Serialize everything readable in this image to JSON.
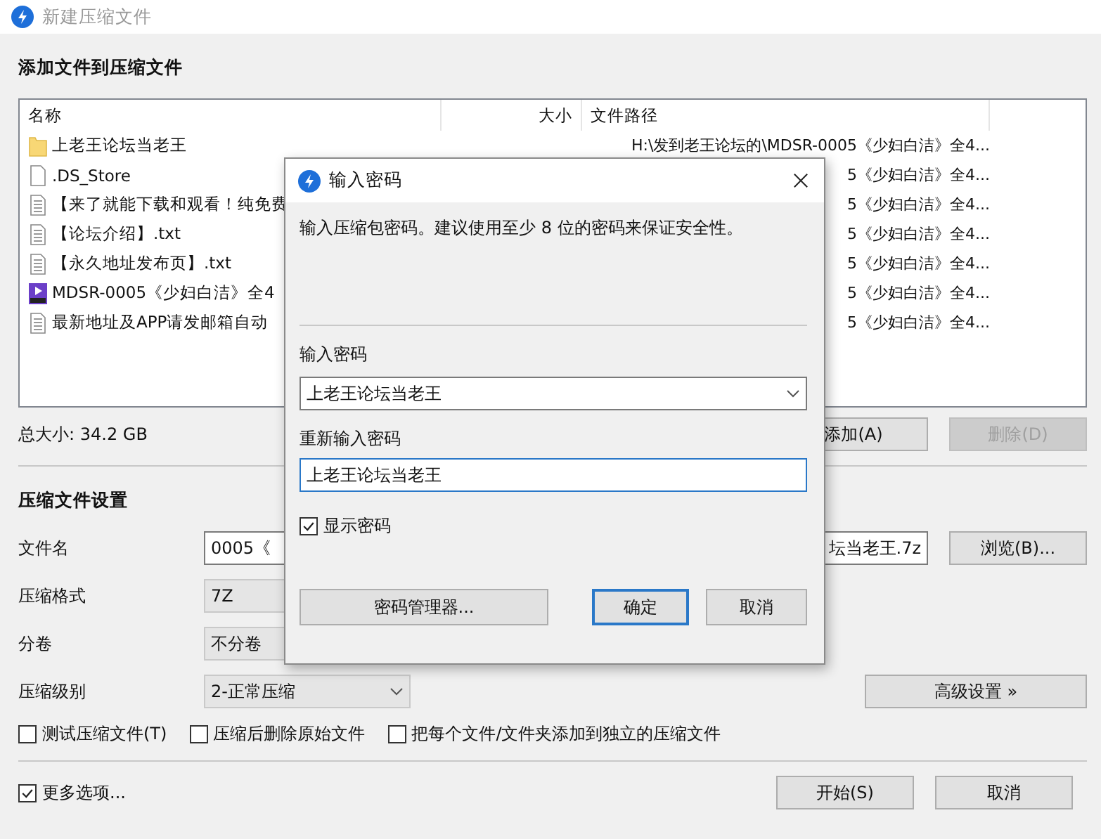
{
  "window": {
    "title": "新建压缩文件"
  },
  "add_section": {
    "heading": "添加文件到压缩文件",
    "file_list": {
      "columns": [
        "名称",
        "大小",
        "文件路径"
      ],
      "rows": [
        {
          "kind": "folder",
          "name": "上老王论坛当老王",
          "path": "H:\\发到老王论坛的\\MDSR-0005《少妇白洁》全4..."
        },
        {
          "kind": "file",
          "name": ".DS_Store",
          "path": "5《少妇白洁》全4..."
        },
        {
          "kind": "text",
          "name": "【来了就能下载和观看！纯免费",
          "path": "5《少妇白洁》全4..."
        },
        {
          "kind": "text",
          "name": "【论坛介绍】.txt",
          "path": "5《少妇白洁》全4..."
        },
        {
          "kind": "text",
          "name": "【永久地址发布页】.txt",
          "path": "5《少妇白洁》全4..."
        },
        {
          "kind": "video",
          "name": "MDSR-0005《少妇白洁》全4",
          "path": "5《少妇白洁》全4..."
        },
        {
          "kind": "text",
          "name": "最新地址及APP请发邮箱自动",
          "path": "5《少妇白洁》全4..."
        }
      ]
    },
    "total_size": "总大小: 34.2 GB",
    "buttons": [
      {
        "label": "添加(A)",
        "disabled": false
      },
      {
        "label": "删除(D)",
        "disabled": true
      }
    ]
  },
  "settings": {
    "heading": "压缩文件设置",
    "filename": {
      "label": "文件名",
      "value_start": "0005《",
      "value_end": "坛当老王.7z"
    },
    "browse_button": "浏览(B)...",
    "format": {
      "label": "压缩格式",
      "value": "7Z"
    },
    "split": {
      "label": "分卷",
      "value": "不分卷"
    },
    "level": {
      "label": "压缩级别",
      "value": "2-正常压缩"
    },
    "advanced_button": "高级设置 »",
    "options": [
      {
        "label": "测试压缩文件(T)",
        "checked": false
      },
      {
        "label": "压缩后删除原始文件",
        "checked": false
      },
      {
        "label": "把每个文件/文件夹添加到独立的压缩文件",
        "checked": false
      }
    ]
  },
  "footer": {
    "more_options": {
      "label": "更多选项...",
      "checked": true
    },
    "buttons": [
      "开始(S)",
      "取消"
    ]
  },
  "password_dialog": {
    "title": "输入密码",
    "description": "输入压缩包密码。建议使用至少 8 位的密码来保证安全性。",
    "password_label": "输入密码",
    "password": "上老王论坛当老王",
    "confirm_label": "重新输入密码",
    "confirm": "上老王论坛当老王",
    "show_password": {
      "label": "显示密码",
      "checked": true
    },
    "manager_button": "密码管理器...",
    "ok_button": "确定",
    "cancel_button": "取消"
  }
}
